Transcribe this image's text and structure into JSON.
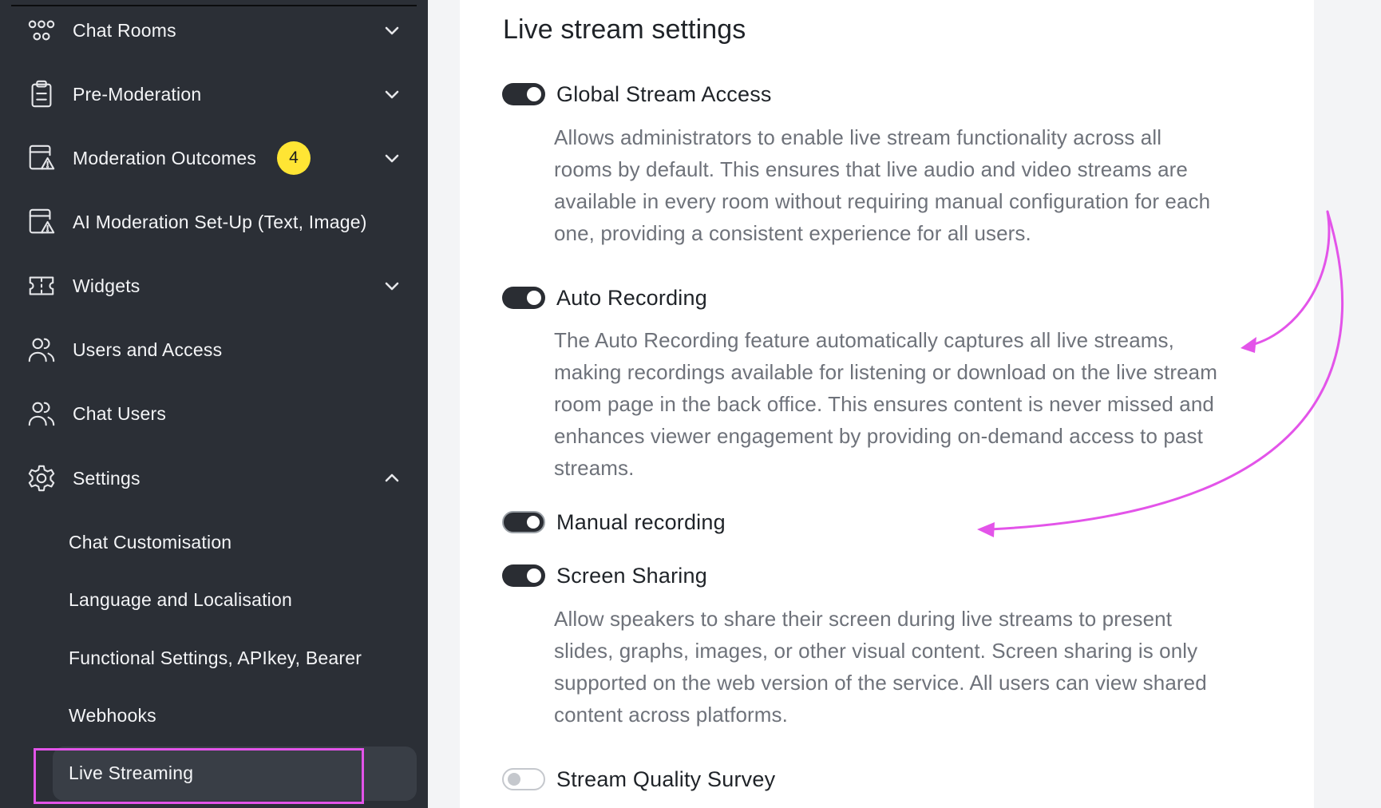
{
  "sidebar": {
    "items": [
      {
        "label": "Chat Rooms",
        "icon": "network-icon",
        "has_chevron": true
      },
      {
        "label": "Pre-Moderation",
        "icon": "clipboard-icon",
        "has_chevron": true
      },
      {
        "label": "Moderation Outcomes",
        "icon": "file-warning-icon",
        "badge": "4",
        "has_chevron": true
      },
      {
        "label": "AI Moderation Set-Up (Text, Image)",
        "icon": "file-warning-icon",
        "has_chevron": false
      },
      {
        "label": "Widgets",
        "icon": "ticket-icon",
        "has_chevron": true
      },
      {
        "label": "Users and Access",
        "icon": "users-icon",
        "has_chevron": false
      },
      {
        "label": "Chat Users",
        "icon": "users-icon",
        "has_chevron": false
      },
      {
        "label": "Settings",
        "icon": "gear-icon",
        "has_chevron": true,
        "expanded": true
      }
    ],
    "settings_subitems": [
      {
        "label": "Chat Customisation"
      },
      {
        "label": "Language and Localisation"
      },
      {
        "label": "Functional Settings, APIkey, Bearer"
      },
      {
        "label": "Webhooks"
      },
      {
        "label": "Live Streaming",
        "active": true
      }
    ]
  },
  "main": {
    "title": "Live stream settings",
    "settings": [
      {
        "title": "Global Stream Access",
        "enabled": true,
        "description_lines": [
          "Allows administrators to enable live stream functionality across all",
          "rooms by default. This ensures that live audio and video streams are",
          "available in every room without requiring manual configuration for each",
          "one, providing a consistent experience for all users."
        ]
      },
      {
        "title": "Auto Recording",
        "enabled": true,
        "description_lines": [
          "The Auto Recording feature automatically captures all live streams,",
          "making recordings available for listening or download on the live stream",
          "room page in the back office. This ensures content is never missed and",
          "enhances viewer engagement by providing on-demand access to past",
          "streams."
        ]
      },
      {
        "title": "Manual recording",
        "enabled": true,
        "description_lines": []
      },
      {
        "title": "Screen Sharing",
        "enabled": true,
        "description_lines": [
          "Allow speakers to share their screen during live streams to present",
          "slides, graphs, images, or other visual content. Screen sharing is only",
          "supported on the web version of the service. All users can view shared",
          "content across platforms."
        ]
      },
      {
        "title": "Stream Quality Survey",
        "enabled": false,
        "description_lines": []
      }
    ]
  },
  "colors": {
    "sidebar_bg": "#2b2f36",
    "badge": "#ffe534",
    "annotation": "#e354e9",
    "toggle_on": "#2a2d33",
    "description_text": "#6e727a"
  }
}
